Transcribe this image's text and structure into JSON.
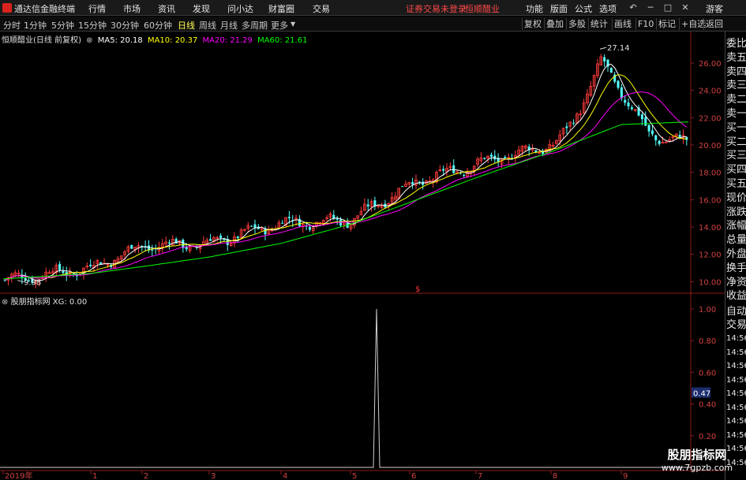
{
  "window": {
    "app_title": "通达信金融终端",
    "menu": [
      "行情",
      "市场",
      "资讯",
      "发现",
      "问小达",
      "财富圈",
      "交易"
    ],
    "warning": "证券交易未登录",
    "stock_name_header": "恒顺醋业",
    "right_menu": [
      "功能",
      "版面",
      "公式",
      "选项"
    ],
    "guest": "游客"
  },
  "period_tabs": [
    {
      "label": "分时",
      "active": false
    },
    {
      "label": "1分钟",
      "active": false
    },
    {
      "label": "5分钟",
      "active": false
    },
    {
      "label": "15分钟",
      "active": false
    },
    {
      "label": "30分钟",
      "active": false
    },
    {
      "label": "60分钟",
      "active": false
    },
    {
      "label": "日线",
      "active": true
    },
    {
      "label": "周线",
      "active": false
    },
    {
      "label": "月线",
      "active": false
    },
    {
      "label": "多周期",
      "active": false
    },
    {
      "label": "更多",
      "active": false
    }
  ],
  "toolbar_buttons": [
    "复权",
    "叠加",
    "多股",
    "统计",
    "画线",
    "F10",
    "标记",
    "+自选",
    "返回"
  ],
  "info": {
    "title": "恒顺醋业(日线 前复权)",
    "ma5": "MA5: 20.18",
    "ma10": "MA10: 20.37",
    "ma20": "MA20: 21.29",
    "ma60": "MA60: 21.61"
  },
  "sub_info": {
    "name": "股朋指标网",
    "xg": "XG: 0.00"
  },
  "annotations": {
    "high": "27.14",
    "low": "9.98",
    "dollar": "$"
  },
  "y_axis_main": [
    "26.00",
    "24.00",
    "22.00",
    "20.00",
    "18.00",
    "16.00",
    "14.00",
    "12.00",
    "10.00"
  ],
  "y_axis_sub": [
    "1.00",
    "0.80",
    "0.60",
    "0.40",
    "0.20"
  ],
  "sub_current": "0.47",
  "x_axis": [
    "2019年",
    "1",
    "2",
    "3",
    "4",
    "5",
    "6",
    "7",
    "8",
    "9"
  ],
  "side_labels": [
    "委比",
    "卖五",
    "卖四",
    "卖三",
    "卖二",
    "卖一",
    "买一",
    "买二",
    "买三",
    "买四",
    "买五",
    "现价",
    "涨跌",
    "涨幅",
    "总量",
    "外盘",
    "换手",
    "净资",
    "收益"
  ],
  "side_trade": [
    "自动",
    "交易"
  ],
  "side_times": [
    "14:56",
    "14:56",
    "14:56",
    "14:56",
    "14:56",
    "14:56",
    "14:56",
    "14:56",
    "14:56",
    "14:56"
  ],
  "watermark": {
    "line1": "股朋指标网",
    "line2": "www.7gpzb.com"
  },
  "colors": {
    "up": "#ff3b3b",
    "down": "#54ffff",
    "ma5": "#ffffff",
    "ma10": "#ffff00",
    "ma20": "#ff00ff",
    "ma60": "#00ff00"
  },
  "chart_data": {
    "type": "line",
    "title": "恒顺醋业(日线 前复权)",
    "ylim": [
      9.5,
      27.5
    ],
    "series": [
      {
        "name": "MA60",
        "x": [
          "2019年",
          "1",
          "2",
          "3",
          "4",
          "5",
          "6",
          "7",
          "8",
          "9"
        ],
        "values": [
          10.2,
          10.6,
          11.1,
          11.8,
          12.8,
          14.2,
          15.8,
          17.6,
          19.5,
          21.5
        ]
      }
    ],
    "close_approx": {
      "x": [
        "2019年",
        "1",
        "2",
        "3",
        "4",
        "5",
        "6",
        "7",
        "8",
        "9"
      ],
      "values": [
        10.1,
        11.0,
        12.6,
        12.8,
        14.3,
        14.5,
        17.1,
        18.6,
        20.0,
        20.2
      ]
    },
    "peak": 27.14,
    "trough": 9.98,
    "sub_series": {
      "name": "XG",
      "spike_value": 1.0,
      "baseline": 0.0,
      "ylim": [
        0,
        1.05
      ]
    }
  }
}
